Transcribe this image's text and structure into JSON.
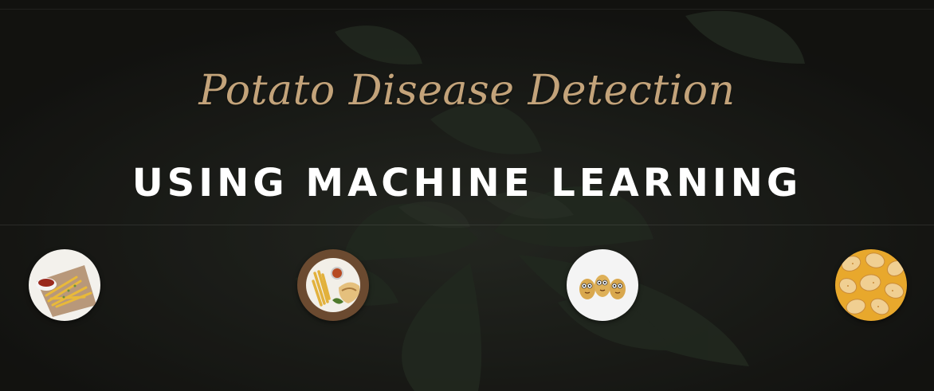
{
  "hero": {
    "script_title": "Potato Disease Detection",
    "main_title": "USING MACHINE LEARNING",
    "accent_color": "#c3a37a",
    "background_image": "dark-potato-plant-leaves"
  },
  "thumbnails": [
    {
      "icon": "french-fries-icon"
    },
    {
      "icon": "fries-and-sandwich-icon"
    },
    {
      "icon": "cartoon-potatoes-icon"
    },
    {
      "icon": "potato-chips-icon"
    }
  ]
}
